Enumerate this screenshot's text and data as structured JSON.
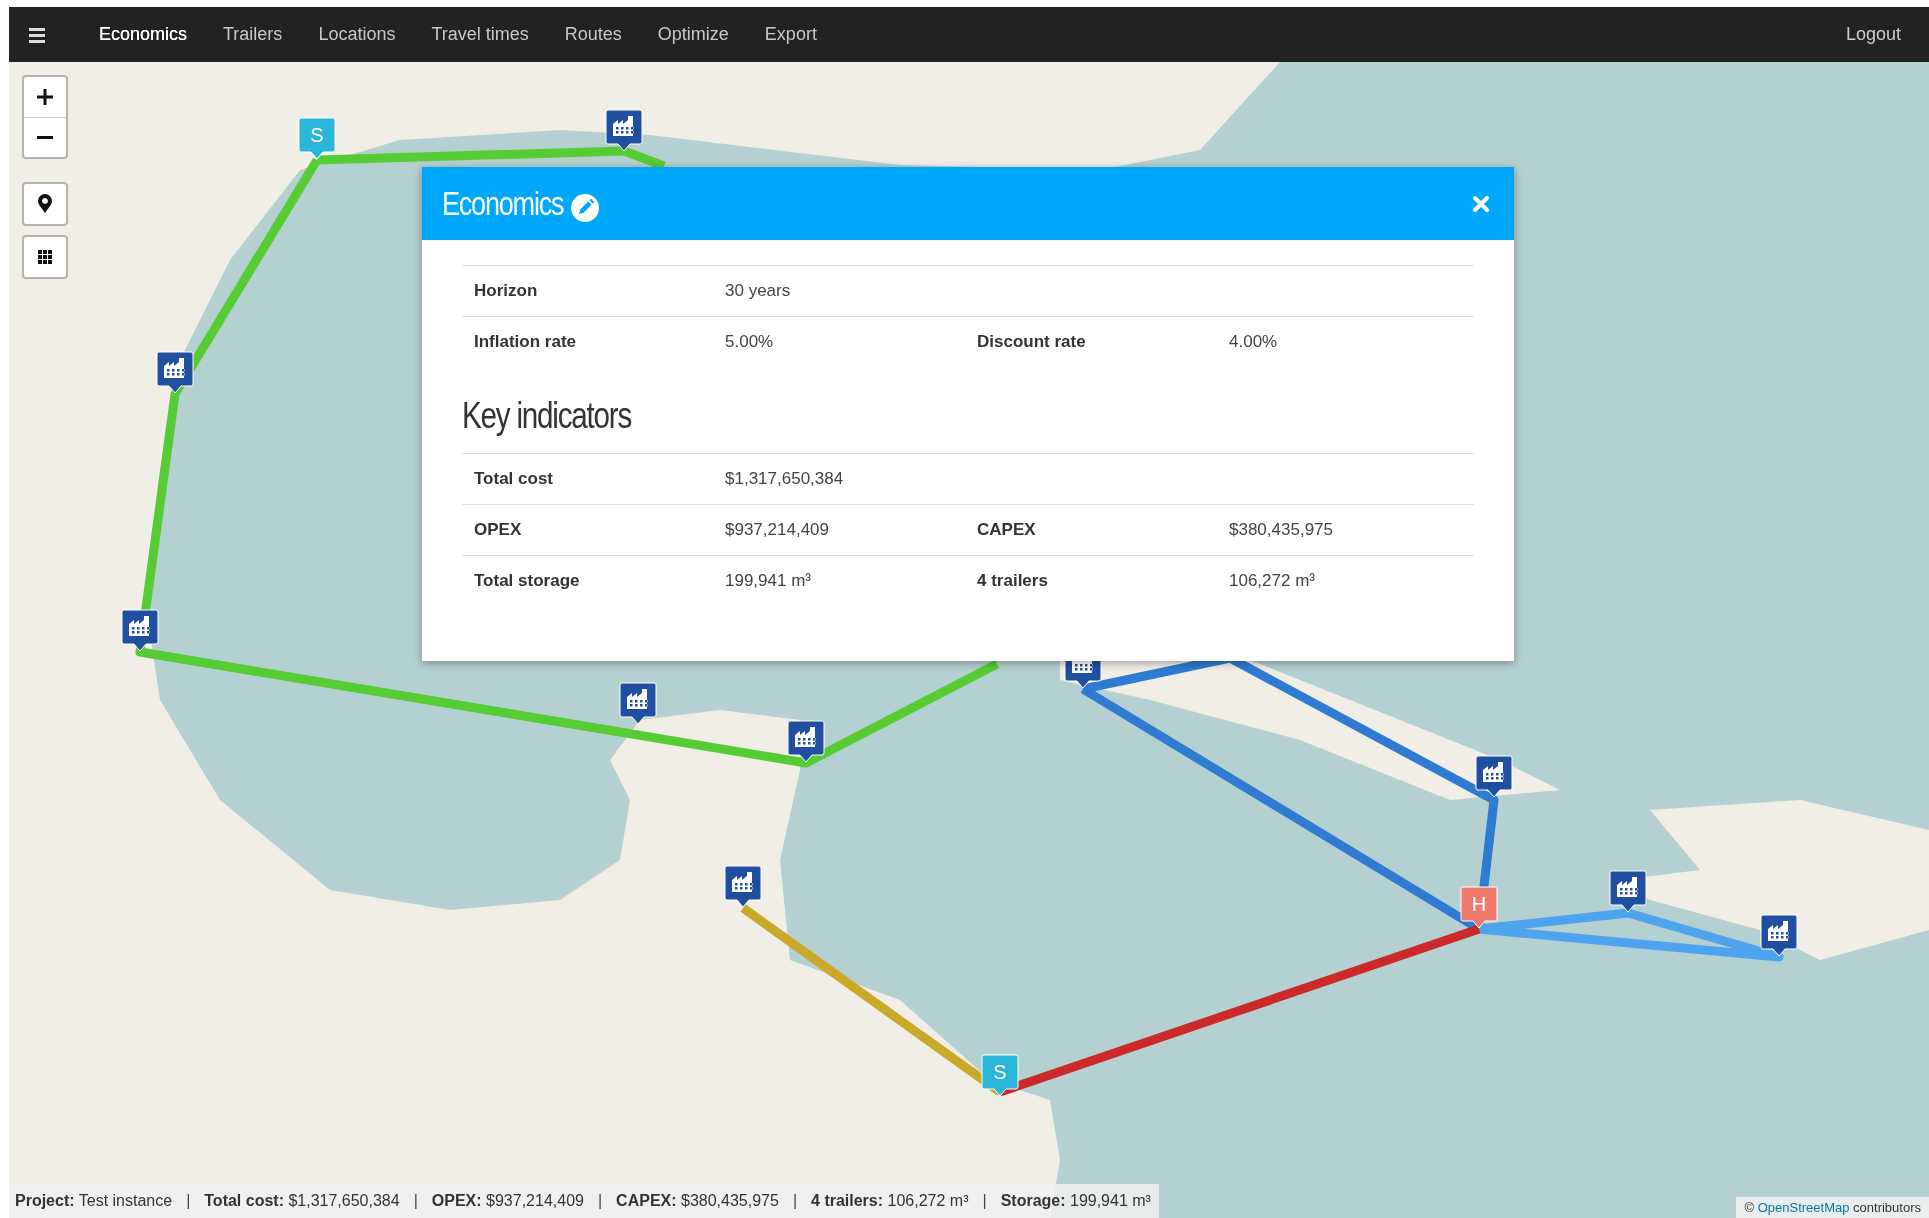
{
  "navbar": {
    "tabs": [
      {
        "label": "Economics",
        "selected": true
      },
      {
        "label": "Trailers",
        "selected": false
      },
      {
        "label": "Locations",
        "selected": false
      },
      {
        "label": "Travel times",
        "selected": false
      },
      {
        "label": "Routes",
        "selected": false
      },
      {
        "label": "Optimize",
        "selected": false
      },
      {
        "label": "Export",
        "selected": false
      }
    ],
    "logout": "Logout"
  },
  "map": {
    "routes": [
      {
        "color": "#55cc33"
      },
      {
        "color": "#55cc33"
      },
      {
        "color": "#2e7bd1"
      },
      {
        "color": "#4da3ee"
      },
      {
        "color": "#cc2a2a"
      },
      {
        "color": "#c9a82a"
      }
    ],
    "markers": [
      {
        "kind": "letter",
        "label": "S",
        "color": "#29b6d9"
      },
      {
        "kind": "factory",
        "color": "#1f4f9e"
      },
      {
        "kind": "factory",
        "color": "#1f4f9e"
      },
      {
        "kind": "factory",
        "color": "#1f4f9e"
      },
      {
        "kind": "factory",
        "color": "#1f4f9e"
      },
      {
        "kind": "factory",
        "color": "#1f4f9e"
      },
      {
        "kind": "factory",
        "color": "#1f4f9e"
      },
      {
        "kind": "factory",
        "color": "#1f4f9e"
      },
      {
        "kind": "factory",
        "color": "#1f4f9e"
      },
      {
        "kind": "factory",
        "color": "#1f4f9e"
      },
      {
        "kind": "factory",
        "color": "#1f4f9e"
      },
      {
        "kind": "letter",
        "label": "H",
        "color": "#f07a6e"
      },
      {
        "kind": "letter",
        "label": "S",
        "color": "#29b6d9"
      }
    ],
    "attribution": {
      "prefix": "©",
      "link": "OpenStreetMap",
      "suffix": "contributors"
    }
  },
  "modal": {
    "title": "Economics",
    "settings": [
      {
        "label": "Horizon",
        "value": "30 years"
      },
      {
        "label": "Inflation rate",
        "value": "5.00%",
        "label2": "Discount rate",
        "value2": "4.00%"
      }
    ],
    "section_title": "Key indicators",
    "indicators": [
      {
        "label": "Total cost",
        "value": "$1,317,650,384"
      },
      {
        "label": "OPEX",
        "value": "$937,214,409",
        "label2": "CAPEX",
        "value2": "$380,435,975"
      },
      {
        "label": "Total storage",
        "value": "199,941 m³",
        "label2": "4 trailers",
        "value2": "106,272 m³"
      }
    ]
  },
  "status_bar": {
    "separator": "|",
    "items": [
      {
        "label": "Project:",
        "value": "Test instance"
      },
      {
        "label": "Total cost:",
        "value": "$1,317,650,384"
      },
      {
        "label": "OPEX:",
        "value": "$937,214,409"
      },
      {
        "label": "CAPEX:",
        "value": "$380,435,975"
      },
      {
        "label": "4 trailers:",
        "value": "106,272 m³"
      },
      {
        "label": "Storage:",
        "value": "199,941 m³"
      }
    ]
  }
}
